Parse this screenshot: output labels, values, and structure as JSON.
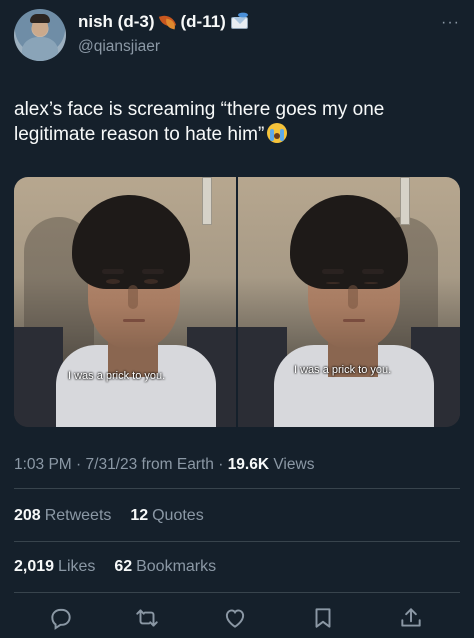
{
  "author": {
    "display_name_part1": "nish (d-3)",
    "display_name_part2": "(d-11)",
    "handle": "@qiansjiaer",
    "emoji_1": "leaf-emoji",
    "emoji_2": "envelope-emoji"
  },
  "tweet": {
    "text": "alex’s face is screaming “there goes my one legitimate reason to hate him”",
    "trailing_emoji": "sob-emoji"
  },
  "media": {
    "images": [
      {
        "caption": "I was a prick to you."
      },
      {
        "caption": "I was a prick to you."
      }
    ]
  },
  "meta": {
    "time": "1:03 PM",
    "date": "7/31/23",
    "source": "from Earth",
    "views_count": "19.6K",
    "views_label": "Views"
  },
  "stats": {
    "retweets_count": "208",
    "retweets_label": "Retweets",
    "quotes_count": "12",
    "quotes_label": "Quotes",
    "likes_count": "2,019",
    "likes_label": "Likes",
    "bookmarks_count": "62",
    "bookmarks_label": "Bookmarks"
  },
  "actions": [
    "reply-icon",
    "retweet-icon",
    "like-icon",
    "bookmark-icon",
    "share-icon"
  ],
  "colors": {
    "background": "#15202b",
    "text_primary": "#f7f9f9",
    "text_secondary": "#8b98a5",
    "divider": "#38444d"
  },
  "more_menu": "···"
}
